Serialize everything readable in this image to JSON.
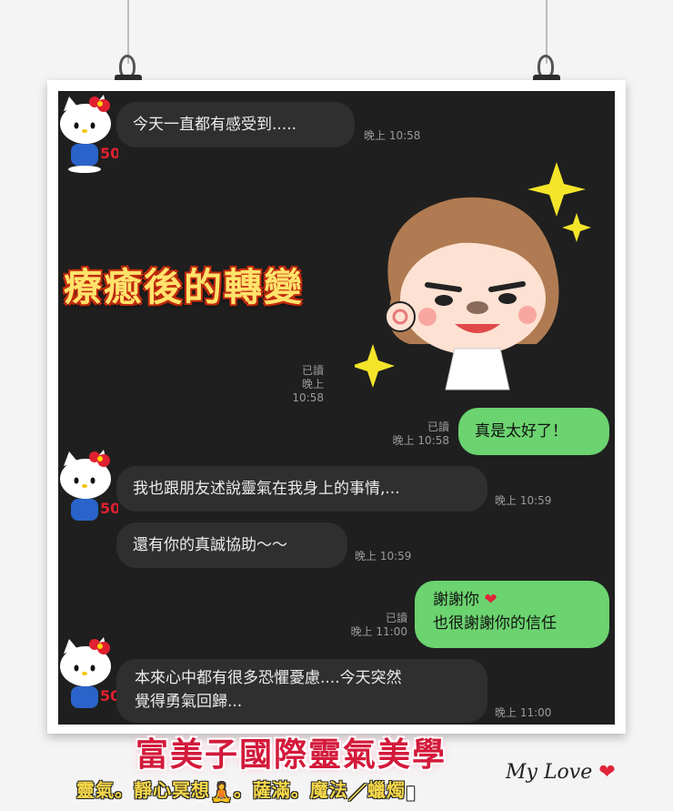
{
  "chat": {
    "messages": [
      {
        "text": "今天一直都有感受到.....",
        "time": "晚上 10:58"
      },
      {
        "read": "已讀",
        "time": "晚上 10:58"
      },
      {
        "text": "真是太好了！",
        "read": "已讀",
        "time": "晚上 10:58"
      },
      {
        "text": "我也跟朋友述說靈氣在我身上的事情,...",
        "time": "晚上 10:59"
      },
      {
        "text": "還有你的真誠協助～～",
        "time": "晚上 10:59"
      },
      {
        "line1": "謝謝你",
        "line2": "也很謝謝你的信任",
        "read": "已讀",
        "time": "晚上 11:00"
      },
      {
        "line1": "本來心中都有很多恐懼憂慮....今天突然",
        "line2": "覺得勇氣回歸...",
        "time": "晚上 11:00"
      }
    ]
  },
  "overlay": {
    "banner": "療癒後的轉變",
    "title": "富美子國際靈氣美學",
    "subtitle_a": "靈氣。靜心冥想",
    "subtitle_b": "。薩滿。魔法",
    "subtitle_c": "蠟燭",
    "signature": "My Love"
  },
  "avatar_badge": "50",
  "colors": {
    "bubble_in": "#2f2f2f",
    "bubble_out": "#6bd36f",
    "chat_bg": "#1f1f1f",
    "accent": "#d31a3b"
  },
  "icons": [
    "hello-kitty-avatar",
    "cartoon-girl-sticker",
    "sparkle-icon",
    "heart-icon",
    "meditation-icon",
    "wand-icon",
    "candle-icon"
  ]
}
